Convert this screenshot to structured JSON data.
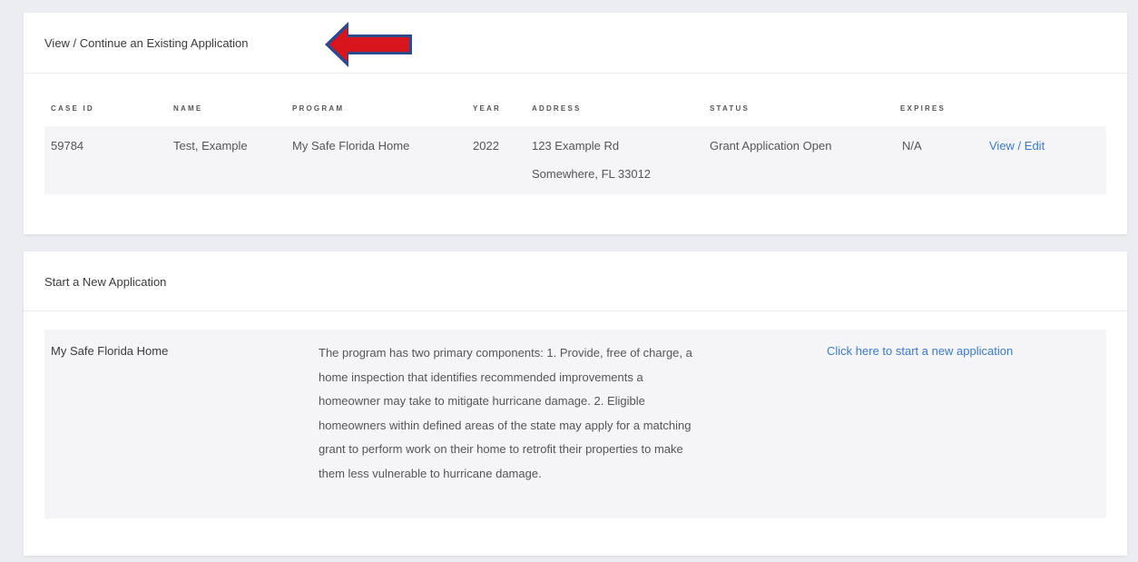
{
  "existing": {
    "title": "View / Continue an Existing Application",
    "columns": [
      "CASE ID",
      "NAME",
      "PROGRAM",
      "YEAR",
      "ADDRESS",
      "STATUS",
      "EXPIRES"
    ],
    "rows": [
      {
        "case_id": "59784",
        "name": "Test, Example",
        "program": "My Safe Florida Home",
        "year": "2022",
        "address_line1": "123 Example Rd",
        "address_line2": "Somewhere, FL 33012",
        "status": "Grant Application Open",
        "expires": "N/A",
        "action_label": "View / Edit"
      }
    ]
  },
  "annotation": {
    "arrow_color": "#d8141c",
    "arrow_outline": "#2d4a8a",
    "icon": "left-arrow-icon"
  },
  "new_application": {
    "title": "Start a New Application",
    "programs": [
      {
        "name": "My Safe Florida Home",
        "description_lines": [
          "The program has two primary components: 1. Provide, free of charge, a",
          "home inspection that identifies recommended improvements a",
          "homeowner may take to mitigate hurricane damage. 2. Eligible",
          "homeowners within defined areas of the state may apply for a matching",
          "grant to perform work on their home to retrofit their properties to make",
          "them less vulnerable to hurricane damage."
        ],
        "action_label": "Click here to start a new application"
      }
    ]
  },
  "colors": {
    "page_background": "#ecedf3",
    "card_background": "#ffffff",
    "row_background": "#f5f5f8",
    "link": "#3a7bc8"
  }
}
